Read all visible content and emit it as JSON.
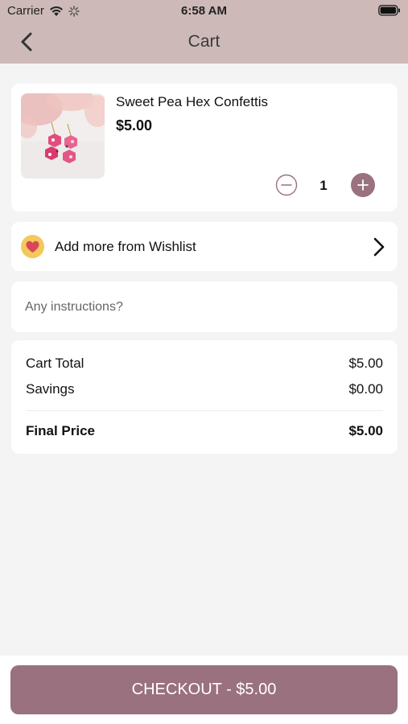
{
  "status_bar": {
    "carrier": "Carrier",
    "time": "6:58 AM"
  },
  "nav": {
    "title": "Cart",
    "back_icon": "chevron-left-icon"
  },
  "cart_item": {
    "name": "Sweet Pea Hex Confettis",
    "price": "$5.00",
    "quantity": "1",
    "image": "earrings-product-image"
  },
  "wishlist": {
    "label": "Add more from Wishlist",
    "icon": "heart-icon",
    "chevron": "chevron-right-icon"
  },
  "instructions": {
    "placeholder": "Any instructions?",
    "value": ""
  },
  "summary": {
    "cart_total_label": "Cart Total",
    "cart_total_value": "$5.00",
    "savings_label": "Savings",
    "savings_value": "$0.00",
    "final_price_label": "Final Price",
    "final_price_value": "$5.00"
  },
  "checkout": {
    "label": "CHECKOUT - $5.00"
  },
  "colors": {
    "header": "#cdbab8",
    "accent": "#9a717e",
    "background": "#f4f4f4",
    "heart_badge": "#f3c95b",
    "heart": "#d9465c"
  }
}
